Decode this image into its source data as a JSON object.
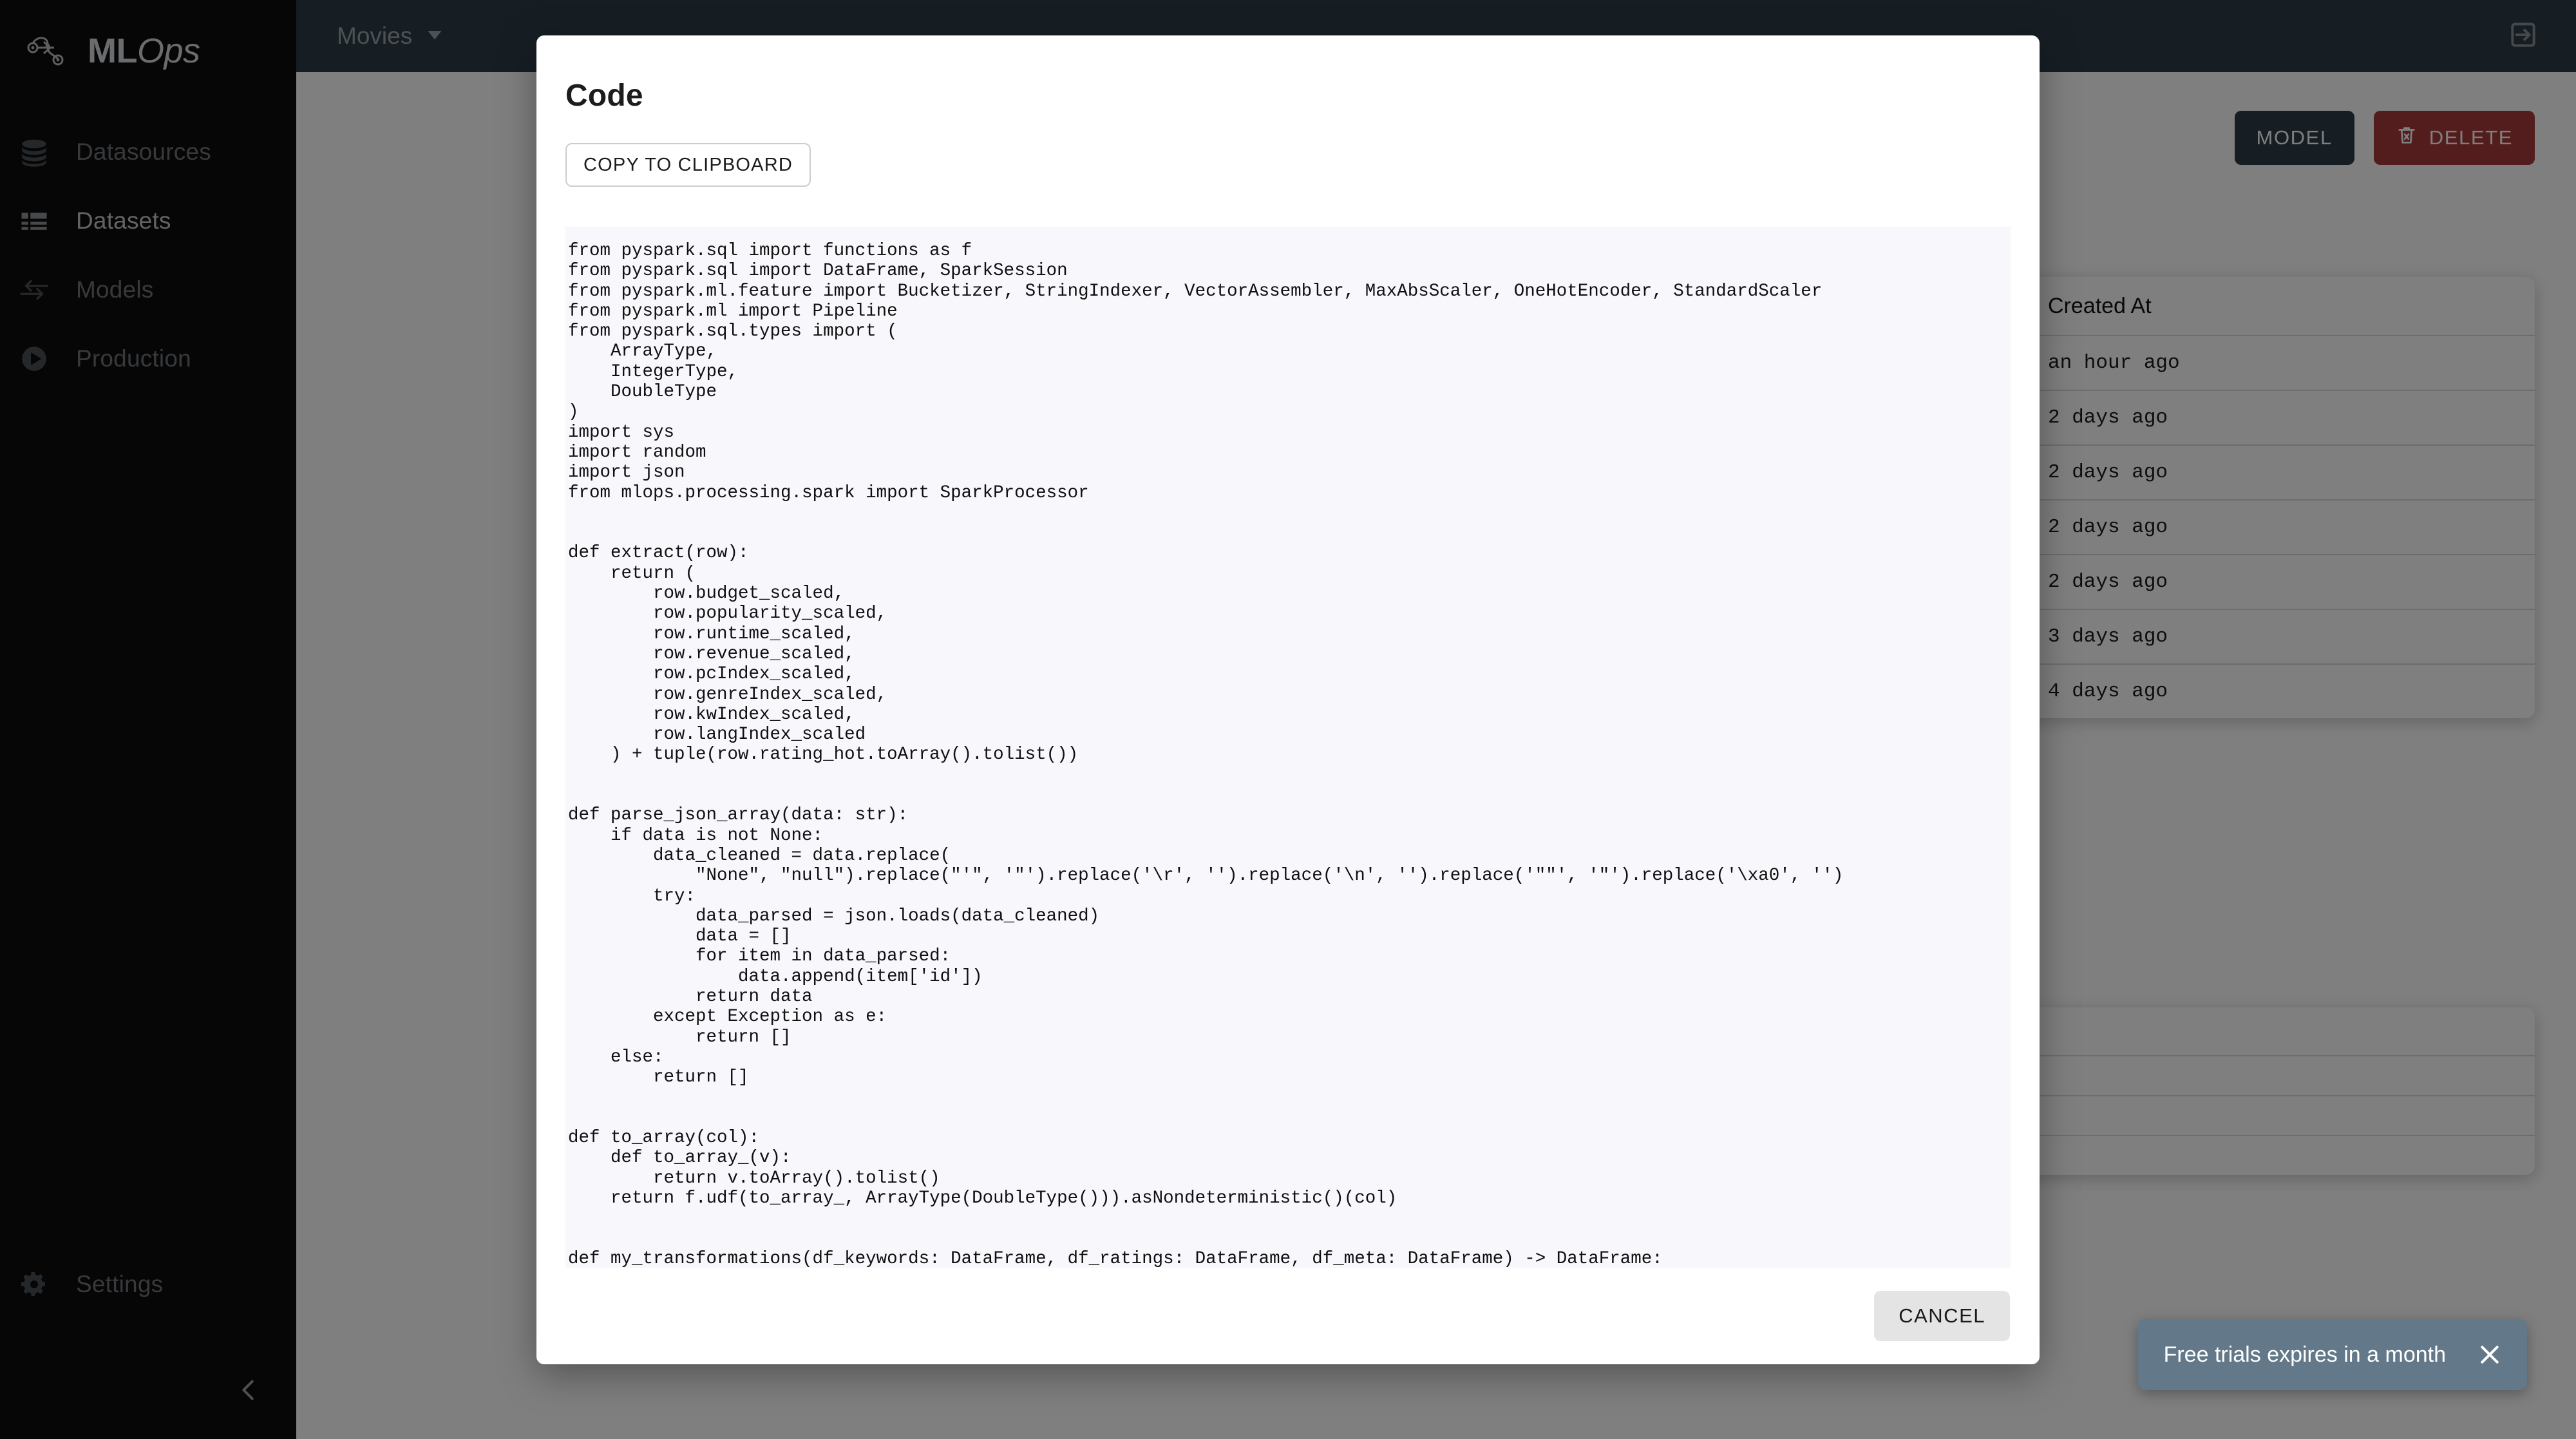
{
  "brand": {
    "bold": "ML",
    "italic": "Ops"
  },
  "sidebar": {
    "items": [
      {
        "label": "Datasources",
        "icon": "database-icon",
        "active": false
      },
      {
        "label": "Datasets",
        "icon": "list-icon",
        "active": true
      },
      {
        "label": "Models",
        "icon": "transfer-icon",
        "active": false
      },
      {
        "label": "Production",
        "icon": "play-icon",
        "active": false
      }
    ],
    "settings_label": "Settings",
    "settings_icon": "gear-icon",
    "collapse_icon": "chevron-left-icon"
  },
  "topbar": {
    "project_label": "Movies",
    "project_caret_icon": "caret-down-icon",
    "logout_icon": "logout-icon",
    "background": "#2e3d47"
  },
  "page": {
    "actions": [
      {
        "label": "MODEL",
        "style": "dark",
        "icon": null
      },
      {
        "label": "DELETE",
        "style": "danger",
        "icon": "trash-icon"
      }
    ],
    "table": {
      "header": "Created At",
      "rows": [
        "an hour ago",
        "2 days ago",
        "2 days ago",
        "2 days ago",
        "2 days ago",
        "3 days ago",
        "4 days ago"
      ]
    },
    "second_table_rows": 4
  },
  "modal": {
    "title": "Code",
    "copy_label": "COPY TO CLIPBOARD",
    "cancel_label": "CANCEL",
    "code": "from pyspark.sql import functions as f\nfrom pyspark.sql import DataFrame, SparkSession\nfrom pyspark.ml.feature import Bucketizer, StringIndexer, VectorAssembler, MaxAbsScaler, OneHotEncoder, StandardScaler\nfrom pyspark.ml import Pipeline\nfrom pyspark.sql.types import (\n    ArrayType,\n    IntegerType,\n    DoubleType\n)\nimport sys\nimport random\nimport json\nfrom mlops.processing.spark import SparkProcessor\n\n\ndef extract(row):\n    return (\n        row.budget_scaled,\n        row.popularity_scaled,\n        row.runtime_scaled,\n        row.revenue_scaled,\n        row.pcIndex_scaled,\n        row.genreIndex_scaled,\n        row.kwIndex_scaled,\n        row.langIndex_scaled\n    ) + tuple(row.rating_hot.toArray().tolist())\n\n\ndef parse_json_array(data: str):\n    if data is not None:\n        data_cleaned = data.replace(\n            \"None\", \"null\").replace(\"'\", '\"').replace('\\r', '').replace('\\n', '').replace('\"\"', '\"').replace('\\xa0', '')\n        try:\n            data_parsed = json.loads(data_cleaned)\n            data = []\n            for item in data_parsed:\n                data.append(item['id'])\n            return data\n        except Exception as e:\n            return []\n    else:\n        return []\n\n\ndef to_array(col):\n    def to_array_(v):\n        return v.toArray().tolist()\n    return f.udf(to_array_, ArrayType(DoubleType())).asNondeterministic()(col)\n\n\ndef my_transformations(df_keywords: DataFrame, df_ratings: DataFrame, df_meta: DataFrame) -> DataFrame:\n    json_array_schema = ArrayType(IntegerType())\n    udf_id_parser = f.udf(lambda x: parse_json_array(x), json_array_schema)"
  },
  "toast": {
    "message": "Free trials expires in a month",
    "close_icon": "close-icon",
    "background": "#63798a"
  }
}
